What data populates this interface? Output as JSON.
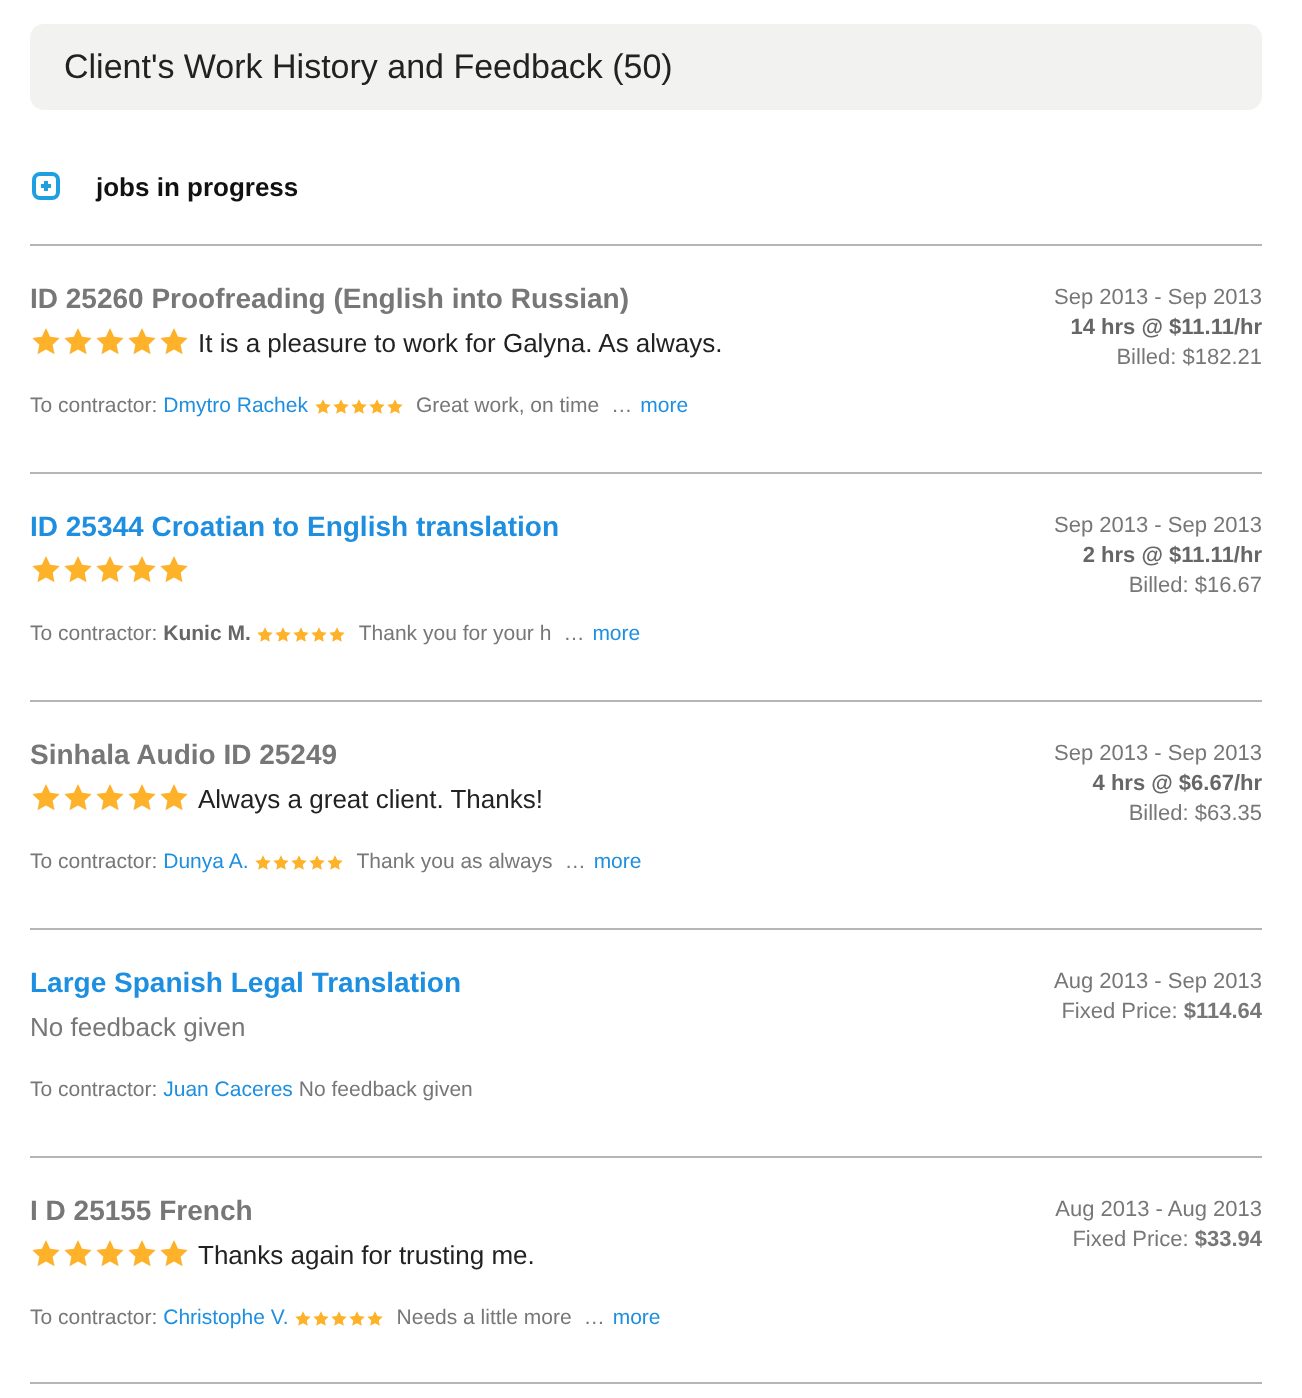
{
  "header": {
    "title": "Client's Work History and Feedback (50)"
  },
  "in_progress": {
    "label": "jobs in progress",
    "expanded": false
  },
  "jobs": [
    {
      "title": "ID 25260 Proofreading (English into Russian)",
      "kind": "plain",
      "stars": 5,
      "feedback": "It is a pleasure to work for Galyna. As always.",
      "contractor_label": "To contractor:",
      "contractor": {
        "name": "Dmytro Rachek",
        "kind": "link",
        "stars": 5,
        "comment": "Great work, on time",
        "ellipsis": "…",
        "more": "more"
      },
      "dates": "Sep 2013 - Sep 2013",
      "lines": [
        {
          "text": "14 hrs @ $11.11/hr",
          "kind": "bold"
        },
        {
          "text": "Billed: $182.21",
          "kind": "plain"
        }
      ]
    },
    {
      "title": "ID 25344 Croatian to English translation",
      "kind": "link",
      "stars": 5,
      "contractor_label": "To contractor:",
      "contractor": {
        "name": "Kunic M.",
        "kind": "bold",
        "stars": 5,
        "comment": "Thank you for your h",
        "ellipsis": "…",
        "more": "more"
      },
      "dates": "Sep 2013 - Sep 2013",
      "lines": [
        {
          "text": "2 hrs @ $11.11/hr",
          "kind": "bold"
        },
        {
          "text": "Billed: $16.67",
          "kind": "plain"
        }
      ]
    },
    {
      "title": "Sinhala Audio ID 25249",
      "kind": "plain",
      "stars": 5,
      "feedback": "Always a great client. Thanks!",
      "contractor_label": "To contractor:",
      "contractor": {
        "name": "Dunya A.",
        "kind": "link",
        "stars": 5,
        "comment": "Thank you as always",
        "ellipsis": "…",
        "more": "more"
      },
      "dates": "Sep 2013 - Sep 2013",
      "lines": [
        {
          "text": "4 hrs @ $6.67/hr",
          "kind": "bold"
        },
        {
          "text": "Billed: $63.35",
          "kind": "plain"
        }
      ]
    },
    {
      "title": "Large Spanish Legal Translation",
      "kind": "link",
      "feedback": "No feedback given",
      "contractor_label": "To contractor:",
      "contractor": {
        "name": "Juan Caceres",
        "kind": "link",
        "comment": "No feedback given"
      },
      "dates": "Aug 2013 - Sep 2013",
      "lines": [
        {
          "text": "Fixed Price: **$114.64**",
          "kind": "plain"
        }
      ]
    },
    {
      "title": "I D 25155 French",
      "kind": "plain",
      "stars": 5,
      "feedback": "Thanks again for trusting me.",
      "contractor_label": "To contractor:",
      "contractor": {
        "name": "Christophe V.",
        "kind": "link",
        "stars": 5,
        "comment": "Needs a little more",
        "ellipsis": "…",
        "more": "more"
      },
      "dates": "Aug 2013 - Aug 2013",
      "lines": [
        {
          "text": "Fixed Price: **$33.94**",
          "kind": "plain"
        }
      ]
    }
  ]
}
